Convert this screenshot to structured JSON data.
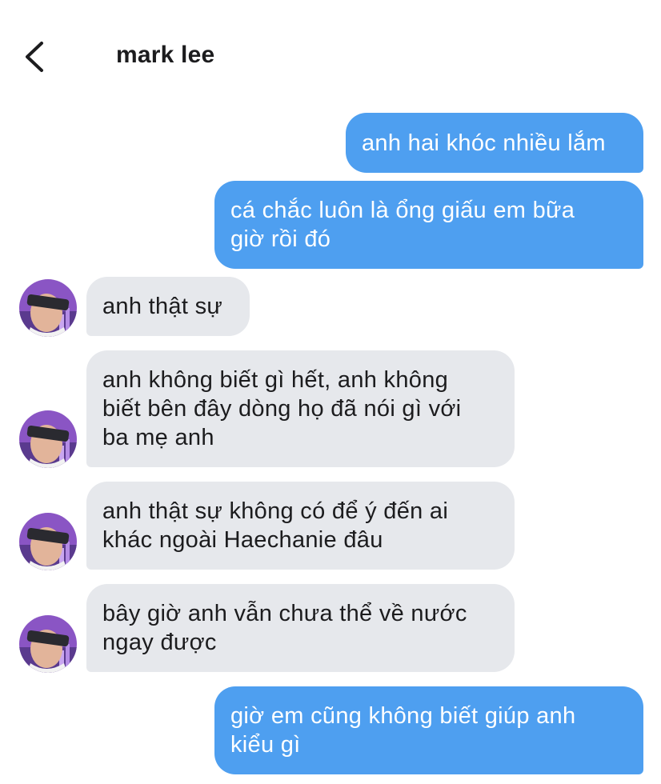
{
  "header": {
    "contact_name": "mark lee",
    "back_icon": "chevron-left-icon"
  },
  "colors": {
    "outgoing_bubble": "#4e9ff0",
    "incoming_bubble": "#e6e8ec",
    "outgoing_text": "#ffffff",
    "incoming_text": "#1c1c1e"
  },
  "messages": [
    {
      "direction": "outgoing",
      "text": "anh hai khóc nhiều lắm"
    },
    {
      "direction": "outgoing",
      "text": "cá chắc luôn là ổng giấu em bữa\ngiờ rồi đó"
    },
    {
      "direction": "incoming",
      "text": "anh thật sự"
    },
    {
      "direction": "incoming",
      "text": "anh không biết gì hết, anh không\nbiết bên đây dòng họ đã nói gì với\nba mẹ anh"
    },
    {
      "direction": "incoming",
      "text": "anh thật sự không có để ý đến ai\nkhác ngoài Haechanie đâu"
    },
    {
      "direction": "incoming",
      "text": "bây giờ anh vẫn chưa thể về nước\nngay được"
    },
    {
      "direction": "outgoing",
      "text": "giờ em cũng không biết giúp anh\nkiểu gì"
    }
  ]
}
